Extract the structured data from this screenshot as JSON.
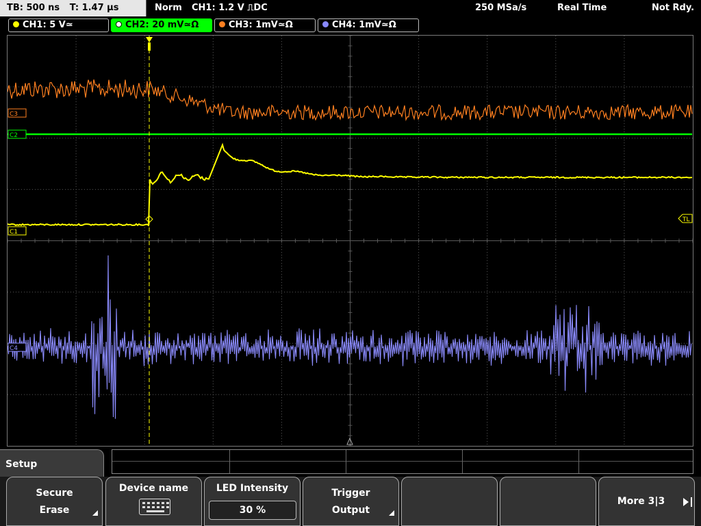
{
  "topbar": {
    "timebase": "TB: 500 ns",
    "trigger_time": "T: 1.47 µs",
    "mode": "Norm",
    "trigger_setting": "CH1: 1.2 V ⎍DC",
    "sample_rate": "250 MSa/s",
    "acquisition": "Real Time",
    "status": "Not Rdy."
  },
  "channels": [
    {
      "label": "CH1: 5 V≃",
      "color": "#ffff00",
      "active": false
    },
    {
      "label": "CH2: 20 mV≃Ω",
      "color": "#00c000",
      "active": true
    },
    {
      "label": "CH3: 1mV≃Ω",
      "color": "#ff8020",
      "active": false
    },
    {
      "label": "CH4: 1mV≃Ω",
      "color": "#8888ff",
      "active": false
    }
  ],
  "markers": {
    "c3": "C3",
    "c2": "C2",
    "c1": "C1",
    "c4": "C4",
    "trigger_level": "TL"
  },
  "colors": {
    "ch1": "#ffff00",
    "ch2": "#00ff00",
    "ch3": "#ff8020",
    "ch4": "#8c8cff",
    "grid": "#5a5a5a"
  },
  "menu": {
    "title": "Setup",
    "softkeys": [
      {
        "line1": "Secure",
        "line2": "Erase",
        "has_submenu": true
      },
      {
        "line1": "Device name",
        "icon": "keyboard-icon"
      },
      {
        "line1": "LED Intensity",
        "value": "30 %"
      },
      {
        "line1": "Trigger",
        "line2": "Output",
        "has_submenu": true
      },
      {
        "line1": ""
      },
      {
        "line1": ""
      },
      {
        "line1": "More 3|3",
        "icon": "next-page-icon"
      }
    ]
  }
}
